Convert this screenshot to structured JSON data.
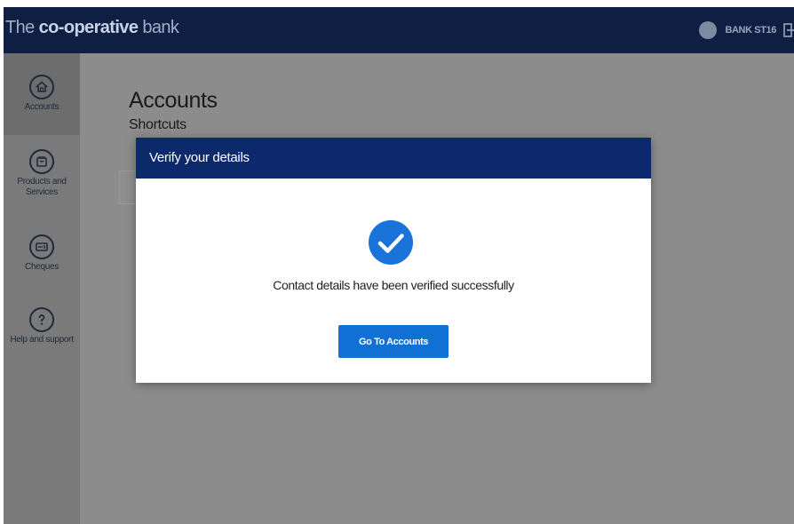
{
  "header": {
    "brand_prefix": "The ",
    "brand_bold": "co-operative",
    "brand_suffix": " bank",
    "user_name": "BANK ST16"
  },
  "sidebar": {
    "items": [
      {
        "label": "Accounts",
        "icon": "home-icon",
        "active": true
      },
      {
        "label": "Products and Services",
        "icon": "wallet-icon",
        "active": false
      },
      {
        "label": "Cheques",
        "icon": "cheque-icon",
        "active": false
      },
      {
        "label": "Help and support",
        "icon": "help-icon",
        "active": false
      }
    ]
  },
  "main": {
    "title": "Accounts",
    "shortcuts_title": "Shortcuts"
  },
  "modal": {
    "title": "Verify your details",
    "message": "Contact details have been verified successfully",
    "button_label": "Go To Accounts",
    "icon": "check-circle-icon"
  },
  "colors": {
    "header_bg": "#0e1f43",
    "modal_header_bg": "#0c2a6b",
    "button_bg": "#1170d4",
    "check_color": "#1a73d9",
    "overlay": "#8c8c8c"
  }
}
